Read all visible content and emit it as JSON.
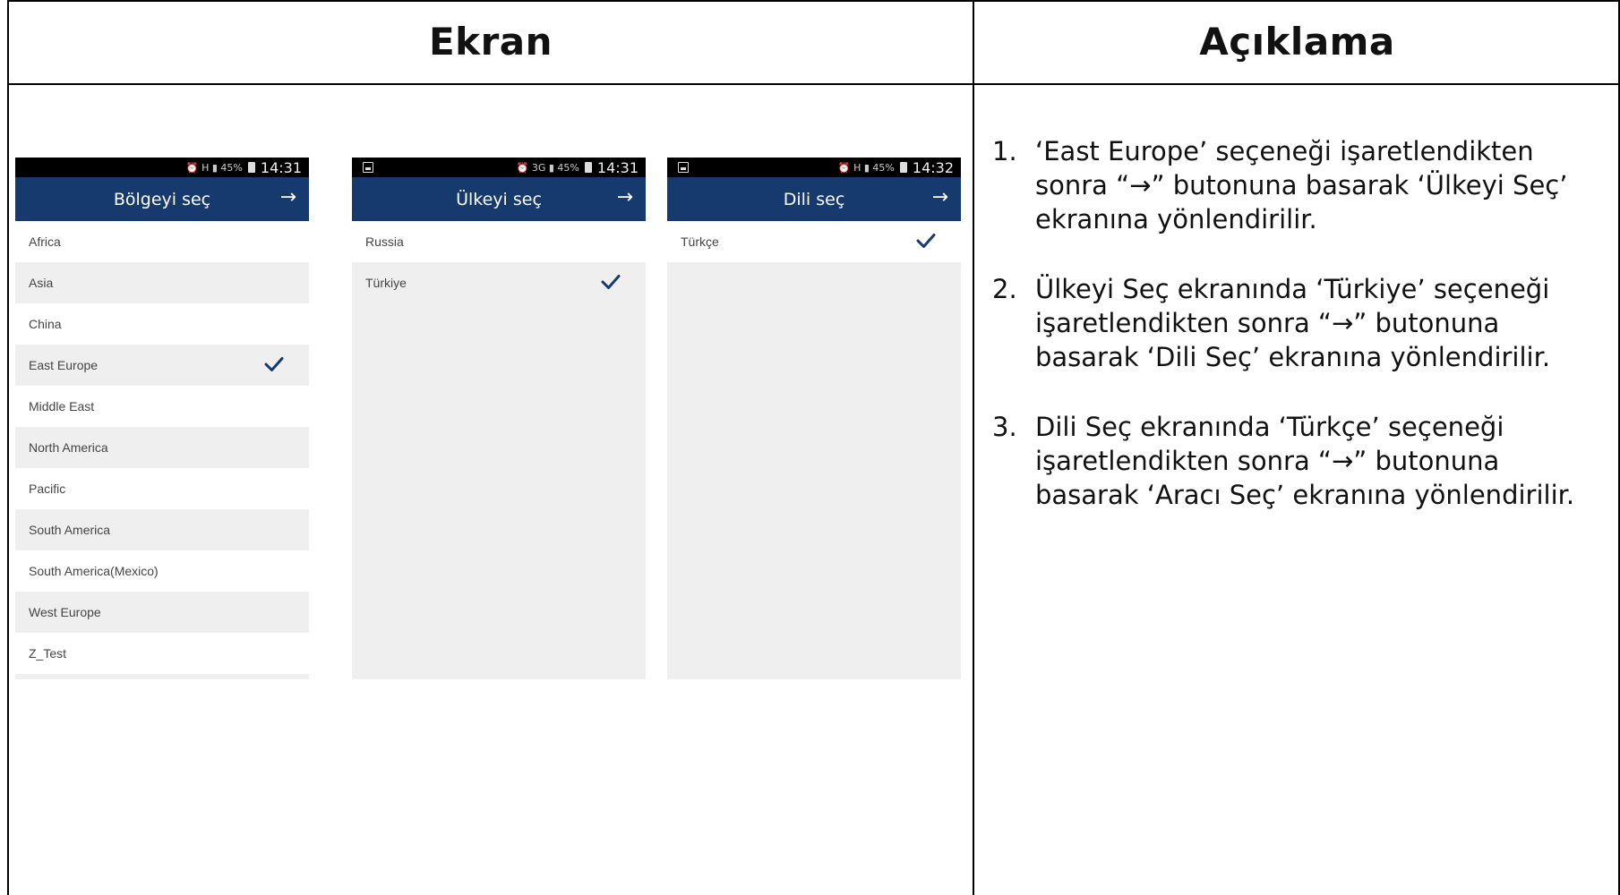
{
  "header": {
    "left_title": "Ekran",
    "right_title": "Açıklama"
  },
  "phones": [
    {
      "status": {
        "left_icon": false,
        "indicators": "⏰ H ▮ 45%",
        "time": "14:31"
      },
      "title": "Bölgeyi seç",
      "arrow": "→",
      "items": [
        "Africa",
        "Asia",
        "China",
        "East Europe",
        "Middle East",
        "North America",
        "Pacific",
        "South America",
        "South America(Mexico)",
        "West Europe",
        "Z_Test"
      ],
      "checked_index": 3
    },
    {
      "status": {
        "left_icon": true,
        "indicators": "⏰ 3G ▮ 45%",
        "time": "14:31"
      },
      "title": "Ülkeyi seç",
      "arrow": "→",
      "items": [
        "Russia",
        "Türkiye"
      ],
      "checked_index": 1
    },
    {
      "status": {
        "left_icon": true,
        "indicators": "⏰ H ▮ 45%",
        "time": "14:32"
      },
      "title": "Dili seç",
      "arrow": "→",
      "items": [
        "Türkçe"
      ],
      "checked_index": 0
    }
  ],
  "description": [
    {
      "num": "1.",
      "text": "‘East Europe’ seçeneği işaretlendikten sonra “→” butonuna basarak ‘Ülkeyi Seç’ ekranına yönlendirilir."
    },
    {
      "num": "2.",
      "text": "Ülkeyi Seç ekranında ‘Türkiye’ seçeneği işaretlendikten sonra “→” butonuna basarak ‘Dili Seç’ ekranına yönlendirilir."
    },
    {
      "num": "3.",
      "text": "Dili Seç ekranında ‘Türkçe’ seçeneği işaretlendikten sonra “→” butonuna basarak ‘Aracı Seç’ ekranına yönlendirilir."
    }
  ],
  "colors": {
    "appbar": "#163a6e",
    "check": "#163a6e"
  }
}
